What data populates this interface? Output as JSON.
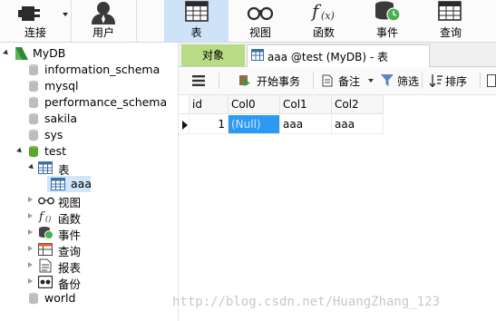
{
  "toolbar": {
    "items": [
      {
        "label": "连接",
        "icon": "plug-icon"
      },
      {
        "label": "用户",
        "icon": "user-icon"
      },
      {
        "label": "表",
        "icon": "table-icon",
        "active": true
      },
      {
        "label": "视图",
        "icon": "glasses-icon"
      },
      {
        "label": "函数",
        "icon": "function-icon"
      },
      {
        "label": "事件",
        "icon": "clock-event-icon"
      },
      {
        "label": "查询",
        "icon": "query-icon"
      }
    ]
  },
  "tree": {
    "connection": "MyDB",
    "databases": [
      "information_schema",
      "mysql",
      "performance_schema",
      "sakila",
      "sys",
      "test",
      "world"
    ],
    "test_children": {
      "tables_label": "表",
      "table_item": "aaa",
      "views_label": "视图",
      "functions_label": "函数",
      "events_label": "事件",
      "queries_label": "查询",
      "reports_label": "报表",
      "backups_label": "备份"
    }
  },
  "tabs": {
    "objects": "对象",
    "table_tab": "aaa @test (MyDB) - 表"
  },
  "data_toolbar": {
    "begin_transaction": "开始事务",
    "memo": "备注",
    "filter": "筛选",
    "sort": "排序"
  },
  "grid": {
    "columns": [
      "id",
      "Col0",
      "Col1",
      "Col2"
    ],
    "rows": [
      [
        "1",
        "(Null)",
        "aaa",
        "aaa"
      ]
    ]
  },
  "colors": {
    "active_tab_bg": "#b8db86",
    "selected_cell": "#2c9af2",
    "toolbar_active": "#cde3f7"
  },
  "watermark": "http://blog.csdn.net/HuangZhang_123"
}
